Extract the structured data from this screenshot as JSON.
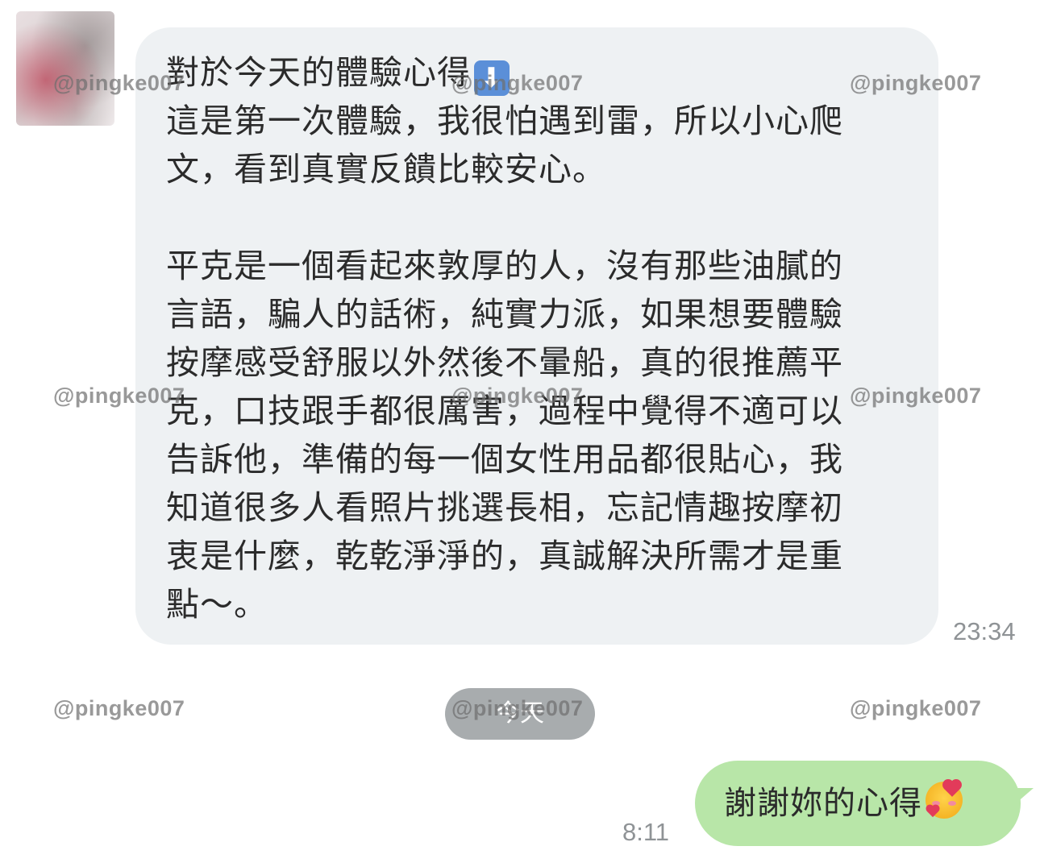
{
  "incoming": {
    "lines": [
      "對於今天的體驗心得",
      "這是第一次體驗，我很怕遇到雷，所以小心爬",
      "文，看到真實反饋比較安心。",
      "",
      "平克是一個看起來敦厚的人，沒有那些油膩的",
      "言語，騙人的話術，純實力派，如果想要體驗",
      "按摩感受舒服以外然後不暈船，真的很推薦平",
      "克，口技跟手都很厲害，過程中覺得不適可以",
      "告訴他，準備的每一個女性用品都很貼心，我",
      "知道很多人看照片挑選長相，忘記情趣按摩初",
      "衷是什麼，乾乾淨淨的，真誠解決所需才是重",
      "點～。"
    ],
    "title_icon": "arrow-down-icon",
    "time": "23:34"
  },
  "date_separator": "今天",
  "outgoing": {
    "text": "謝謝妳的心得",
    "emoji": "smiling-face-with-hearts-icon",
    "time": "8:11"
  },
  "watermark": "@pingke007",
  "colors": {
    "incoming_bubble": "#eef1f3",
    "outgoing_bubble": "#b8e6a8",
    "date_pill": "#a8acae",
    "timestamp": "#8f9396"
  }
}
